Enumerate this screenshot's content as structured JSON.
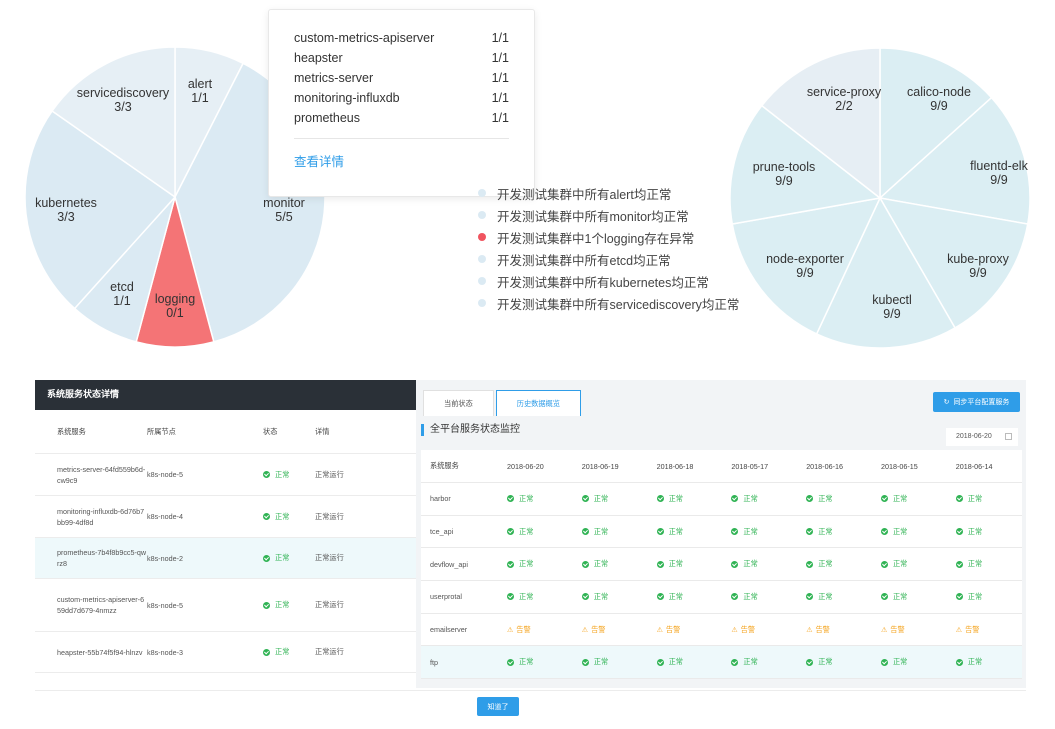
{
  "pie_left": {
    "slices": [
      {
        "name": "alert",
        "value": "1/1"
      },
      {
        "name": "monitor",
        "value": "5/5"
      },
      {
        "name": "logging",
        "value": "0/1"
      },
      {
        "name": "etcd",
        "value": "1/1"
      },
      {
        "name": "kubernetes",
        "value": "3/3"
      },
      {
        "name": "servicediscovery",
        "value": "3/3"
      }
    ],
    "colors": {
      "normal": "#dbeaf3",
      "alert": "#e6eff5",
      "error": "#f47476"
    }
  },
  "pie_right": {
    "slices": [
      {
        "name": "calico-node",
        "value": "9/9"
      },
      {
        "name": "fluentd-elk",
        "value": "9/9"
      },
      {
        "name": "kube-proxy",
        "value": "9/9"
      },
      {
        "name": "kubectl",
        "value": "9/9"
      },
      {
        "name": "node-exporter",
        "value": "9/9"
      },
      {
        "name": "prune-tools",
        "value": "9/9"
      },
      {
        "name": "service-proxy",
        "value": "2/2"
      }
    ],
    "colors": {
      "normal": "#dbeef3",
      "alt": "#e6eef4"
    }
  },
  "tooltip": {
    "rows": [
      {
        "name": "custom-metrics-apiserver",
        "value": "1/1"
      },
      {
        "name": "heapster",
        "value": "1/1"
      },
      {
        "name": "metrics-server",
        "value": "1/1"
      },
      {
        "name": "monitoring-influxdb",
        "value": "1/1"
      },
      {
        "name": "prometheus",
        "value": "1/1"
      }
    ],
    "link": "查看详情"
  },
  "status_list": [
    {
      "text": "开发测试集群中所有alert均正常",
      "error": false
    },
    {
      "text": "开发测试集群中所有monitor均正常",
      "error": false
    },
    {
      "text": "开发测试集群中1个logging存在异常",
      "error": true
    },
    {
      "text": "开发测试集群中所有etcd均正常",
      "error": false
    },
    {
      "text": "开发测试集群中所有kubernetes均正常",
      "error": false
    },
    {
      "text": "开发测试集群中所有servicediscovery均正常",
      "error": false
    }
  ],
  "left_panel": {
    "title": "系统服务状态详情",
    "headers": [
      "系统服务",
      "所属节点",
      "状态",
      "详情"
    ],
    "rows": [
      {
        "service": "metrics-server-64fd559b6d-cw9c9",
        "node": "k8s-node-5",
        "status": "正常",
        "detail": "正常运行"
      },
      {
        "service": "monitoring-influxdb-6d76b7bb99-4df8d",
        "node": "k8s-node-4",
        "status": "正常",
        "detail": "正常运行"
      },
      {
        "service": "prometheus-7b4f8b9cc5-qwrz8",
        "node": "k8s-node-2",
        "status": "正常",
        "detail": "正常运行"
      },
      {
        "service": "custom-metrics-apiserver-659dd7d679-4nmzz",
        "node": "k8s-node-5",
        "status": "正常",
        "detail": "正常运行"
      },
      {
        "service": "heapster-55b74f5f94-hlnzv",
        "node": "k8s-node-3",
        "status": "正常",
        "detail": "正常运行"
      }
    ]
  },
  "right_panel": {
    "tabs": [
      "当前状态",
      "历史数据概览"
    ],
    "sync_button": "同步平台配置服务",
    "section_title": "全平台服务状态监控",
    "date": "2018-06-20",
    "headers": [
      "系统服务",
      "2018-06-20",
      "2018-06-19",
      "2018-06-18",
      "2018-05-17",
      "2018-06-16",
      "2018-06-15",
      "2018-06-14"
    ],
    "ok_label": "正常",
    "warn_label": "告警",
    "rows": [
      {
        "service": "harbor",
        "status": "ok"
      },
      {
        "service": "tce_api",
        "status": "ok"
      },
      {
        "service": "devflow_api",
        "status": "ok"
      },
      {
        "service": "userprotal",
        "status": "ok"
      },
      {
        "service": "emailserver",
        "status": "warn"
      },
      {
        "service": "ftp",
        "status": "ok"
      }
    ]
  },
  "ok_button": "知道了"
}
